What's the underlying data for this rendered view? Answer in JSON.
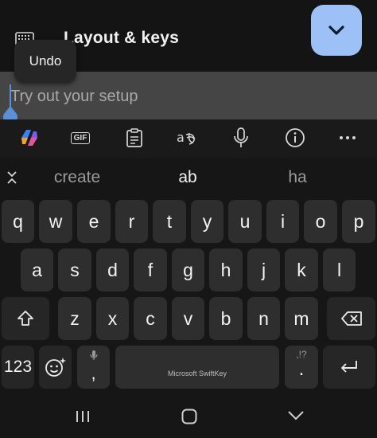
{
  "header": {
    "title": "Layout & keys"
  },
  "undo": {
    "label": "Undo"
  },
  "input": {
    "placeholder": "Try out your setup"
  },
  "toolbar": {
    "gif_label": "GIF"
  },
  "suggestions": [
    "create",
    "ab",
    "ha"
  ],
  "rows": {
    "row1": [
      "q",
      "w",
      "e",
      "r",
      "t",
      "y",
      "u",
      "i",
      "o",
      "p"
    ],
    "row2": [
      "a",
      "s",
      "d",
      "f",
      "g",
      "h",
      "j",
      "k",
      "l"
    ],
    "row3": [
      "z",
      "x",
      "c",
      "v",
      "b",
      "n",
      "m"
    ]
  },
  "bottom": {
    "numbers_label": "123",
    "comma_label": ",",
    "space_label": "Microsoft SwiftKey",
    "period_label": ".",
    "period_hint": ",!?"
  },
  "colors": {
    "accent": "#9dc1f7",
    "cursor": "#5b8fd9",
    "key_bg": "#2e2e2e"
  }
}
